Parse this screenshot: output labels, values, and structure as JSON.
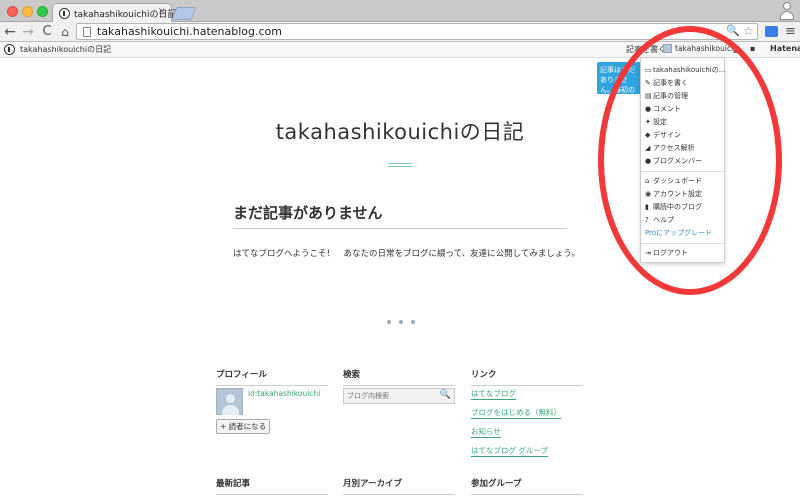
{
  "browser": {
    "tab_title": "takahashikouichiの日記",
    "tab_close": "×",
    "url": "takahashikouichi.hatenablog.com",
    "nav_back": "←",
    "nav_forward": "→",
    "nav_reload": "C",
    "nav_home": "⌂",
    "zoom_icon": "🔍",
    "star_icon": "☆",
    "menu_icon": "≡"
  },
  "hatena_bar": {
    "blog_name": "takahashikouichiの日記",
    "write_link": "記事を書く",
    "username": "takahashikouichi",
    "grid_icon": "▦",
    "chat_icon": "▪",
    "brand": "Hatena"
  },
  "tooltip": {
    "text": "記事はまだありません。最初の記事を書いてみましょう"
  },
  "dropdown": {
    "items": [
      {
        "icon": "▭",
        "label": "takahashikouichiの..."
      },
      {
        "icon": "✎",
        "label": "記事を書く"
      },
      {
        "icon": "▤",
        "label": "記事の管理"
      },
      {
        "icon": "●",
        "label": "コメント"
      },
      {
        "icon": "✦",
        "label": "設定"
      },
      {
        "icon": "◆",
        "label": "デザイン"
      },
      {
        "icon": "◢",
        "label": "アクセス解析"
      },
      {
        "icon": "●",
        "label": "ブログメンバー"
      },
      {
        "icon": "⌂",
        "label": "ダッシュボード"
      },
      {
        "icon": "◉",
        "label": "アカウント設定"
      },
      {
        "icon": "▮",
        "label": "購読中のブログ"
      },
      {
        "icon": "?",
        "label": "ヘルプ"
      },
      {
        "icon": "",
        "label": "Proにアップグレード"
      },
      {
        "icon": "⇥",
        "label": "ログアウト"
      }
    ]
  },
  "blog": {
    "title": "takahashikouichiの日記",
    "no_entries": "まだ記事がありません",
    "welcome": "はてなブログへようこそ！　あなたの日常をブログに綴って、友達に公開してみましょう。"
  },
  "sidebar": {
    "profile": {
      "heading": "プロフィール",
      "id": "id:takahashikouichi",
      "reader_button": "+ 読者になる"
    },
    "search": {
      "heading": "検索",
      "placeholder": "ブログ内検索",
      "icon": "🔍"
    },
    "links": {
      "heading": "リンク",
      "items": [
        "はてなブログ",
        "ブログをはじめる（無料）",
        "お知らせ",
        "はてなブログ グループ"
      ]
    },
    "recent": {
      "heading": "最新記事"
    },
    "archive": {
      "heading": "月別アーカイブ"
    },
    "groups": {
      "heading": "参加グループ"
    }
  },
  "colors": {
    "accent_green": "#3aa876",
    "annotation_red": "#f2393a",
    "tooltip_blue": "#2fa4e0",
    "upgrade_blue": "#3a8fd0"
  }
}
